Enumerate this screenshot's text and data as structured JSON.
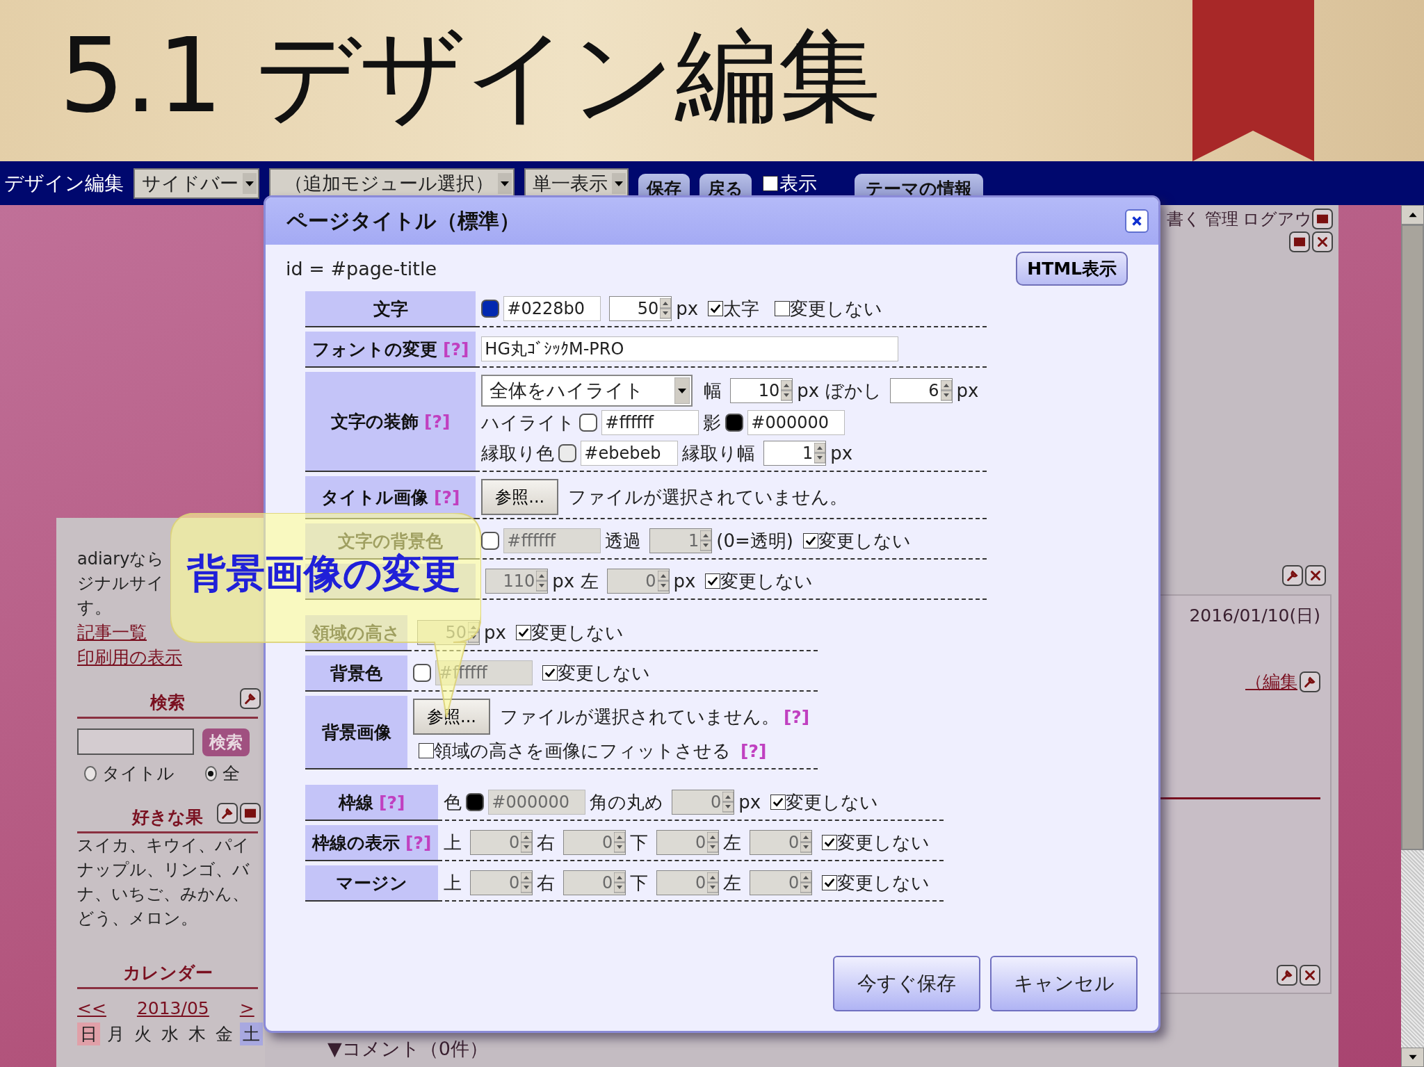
{
  "slide_title": "5.1 デザイン編集",
  "toolbar": {
    "title": "デザイン編集",
    "selects": [
      "サイドバー",
      "（追加モジュール選択）",
      "単一表示"
    ],
    "buttons": [
      "保存",
      "戻る"
    ],
    "show_check": {
      "label": "表示",
      "checked": false
    },
    "info_button": "テーマの情報"
  },
  "sidebar": {
    "intro_lines": [
      "adiaryなら",
      "ジナルサイ",
      "す。"
    ],
    "links": [
      "記事一覧",
      "印刷用の表示"
    ],
    "search": {
      "heading": "検索",
      "button": "検索",
      "radios": [
        {
          "label": "タイトル",
          "selected": false
        },
        {
          "label": "全",
          "selected": true
        }
      ]
    },
    "fruits": {
      "heading": "好きな果",
      "lines": [
        "スイカ、キウイ、パイ",
        "ナップル、リンゴ、バ",
        "ナ、いちご、みかん、",
        "どう、メロン。"
      ]
    },
    "calendar": {
      "heading": "カレンダー",
      "prev": "<<",
      "month": "2013/05",
      "next": ">",
      "weekdays": [
        {
          "text": "日",
          "color": "#e0a0a8"
        },
        {
          "text": "月"
        },
        {
          "text": "火"
        },
        {
          "text": "水"
        },
        {
          "text": "木"
        },
        {
          "text": "金"
        },
        {
          "text": "土",
          "color": "#a8a8e0"
        }
      ]
    }
  },
  "main": {
    "top_links": [
      "書く",
      "管理",
      "ログアウ"
    ],
    "date": "2016/01/10(日)",
    "edit_link": "（編集",
    "comments": "▼コメント（0件）"
  },
  "dialog": {
    "title": "ページタイトル（標準）",
    "id_line": "id = #page-title",
    "html_button": "HTML表示",
    "sections": [
      {
        "rows": [
          {
            "label": "文字",
            "lines": [
              [
                {
                  "kind": "swatch",
                  "color": "#0228b0"
                },
                {
                  "kind": "text",
                  "value": "#0228b0",
                  "disabled": false
                },
                {
                  "kind": "spin",
                  "value": "50",
                  "disabled": false
                },
                {
                  "kind": "word",
                  "text": "px"
                },
                {
                  "kind": "check",
                  "label": "太字",
                  "checked": true
                },
                {
                  "kind": "check",
                  "label": "変更しない",
                  "checked": false
                }
              ]
            ]
          },
          {
            "label": "フォントの変更",
            "help": "[?]",
            "lines": [
              [
                {
                  "kind": "long_text",
                  "value": "HG丸ｺﾞｼｯｸM-PRO"
                }
              ]
            ]
          },
          {
            "label": "文字の装飾",
            "help": "[?]",
            "lines": [
              [
                {
                  "kind": "select",
                  "value": "全体をハイライト"
                },
                {
                  "kind": "word",
                  "text": "幅"
                },
                {
                  "kind": "spin",
                  "value": "10",
                  "disabled": false
                },
                {
                  "kind": "word",
                  "text": "px ぼかし"
                },
                {
                  "kind": "spin",
                  "value": "6",
                  "disabled": false
                },
                {
                  "kind": "word",
                  "text": "px"
                }
              ],
              [
                {
                  "kind": "word",
                  "text": "ハイライト"
                },
                {
                  "kind": "swatch",
                  "color": "#ffffff"
                },
                {
                  "kind": "text",
                  "value": "#ffffff",
                  "disabled": false
                },
                {
                  "kind": "word",
                  "text": "影"
                },
                {
                  "kind": "swatch",
                  "color": "#000000"
                },
                {
                  "kind": "text",
                  "value": "#000000",
                  "disabled": false
                }
              ],
              [
                {
                  "kind": "word",
                  "text": "縁取り色"
                },
                {
                  "kind": "swatch",
                  "color": "#ebebeb"
                },
                {
                  "kind": "text",
                  "value": "#ebebeb",
                  "disabled": false
                },
                {
                  "kind": "word",
                  "text": "縁取り幅"
                },
                {
                  "kind": "spin",
                  "value": "1",
                  "disabled": false
                },
                {
                  "kind": "word",
                  "text": "px"
                }
              ]
            ]
          },
          {
            "label": "タイトル画像",
            "help": "[?]",
            "lines": [
              [
                {
                  "kind": "browse",
                  "label": "参照..."
                },
                {
                  "kind": "word",
                  "text": "ファイルが選択されていません。"
                }
              ]
            ]
          },
          {
            "label": "文字の背景色",
            "lines": [
              [
                {
                  "kind": "swatch",
                  "color": "#ffffff"
                },
                {
                  "kind": "text",
                  "value": "#ffffff",
                  "disabled": true
                },
                {
                  "kind": "word",
                  "text": "透過"
                },
                {
                  "kind": "spin",
                  "value": "1",
                  "disabled": true
                },
                {
                  "kind": "word",
                  "text": "(0=透明)"
                },
                {
                  "kind": "check",
                  "label": "変更しない",
                  "checked": true
                }
              ]
            ]
          },
          {
            "lines": [
              [
                {
                  "kind": "spin",
                  "value": "110",
                  "disabled": true
                },
                {
                  "kind": "word",
                  "text": "px 左"
                },
                {
                  "kind": "spin",
                  "value": "0",
                  "disabled": true
                },
                {
                  "kind": "word",
                  "text": "px"
                },
                {
                  "kind": "check",
                  "label": "変更しない",
                  "checked": true
                }
              ]
            ]
          }
        ]
      },
      {
        "rows": [
          {
            "label": "領域の高さ",
            "lines": [
              [
                {
                  "kind": "spin",
                  "value": "50",
                  "disabled": true
                },
                {
                  "kind": "word",
                  "text": "px"
                },
                {
                  "kind": "check",
                  "label": "変更しない",
                  "checked": true
                }
              ]
            ]
          },
          {
            "label": "背景色",
            "lines": [
              [
                {
                  "kind": "swatch",
                  "color": "#ffffff"
                },
                {
                  "kind": "text",
                  "value": "#ffffff",
                  "disabled": true
                },
                {
                  "kind": "check",
                  "label": "変更しない",
                  "checked": true
                }
              ]
            ]
          },
          {
            "label": "背景画像",
            "lines": [
              [
                {
                  "kind": "browse",
                  "label": "参照..."
                },
                {
                  "kind": "word",
                  "text": "ファイルが選択されていません。"
                },
                {
                  "kind": "help",
                  "text": "[?]"
                }
              ],
              [
                {
                  "kind": "check",
                  "label": "領域の高さを画像にフィットさせる",
                  "checked": false
                },
                {
                  "kind": "help",
                  "text": "[?]"
                }
              ]
            ]
          }
        ]
      },
      {
        "rows": [
          {
            "label": "枠線",
            "help": "[?]",
            "lines": [
              [
                {
                  "kind": "word",
                  "text": "色"
                },
                {
                  "kind": "swatch",
                  "color": "#000000"
                },
                {
                  "kind": "text",
                  "value": "#000000",
                  "disabled": true
                },
                {
                  "kind": "word",
                  "text": "角の丸め"
                },
                {
                  "kind": "spin",
                  "value": "0",
                  "disabled": true
                },
                {
                  "kind": "word",
                  "text": "px"
                },
                {
                  "kind": "check",
                  "label": "変更しない",
                  "checked": true
                }
              ]
            ]
          },
          {
            "label": "枠線の表示",
            "help": "[?]",
            "lines": [
              [
                {
                  "kind": "word",
                  "text": "上"
                },
                {
                  "kind": "spin",
                  "value": "0",
                  "disabled": true
                },
                {
                  "kind": "word",
                  "text": "右"
                },
                {
                  "kind": "spin",
                  "value": "0",
                  "disabled": true
                },
                {
                  "kind": "word",
                  "text": "下"
                },
                {
                  "kind": "spin",
                  "value": "0",
                  "disabled": true
                },
                {
                  "kind": "word",
                  "text": "左"
                },
                {
                  "kind": "spin",
                  "value": "0",
                  "disabled": true
                },
                {
                  "kind": "check",
                  "label": "変更しない",
                  "checked": true
                }
              ]
            ]
          },
          {
            "label": "マージン",
            "lines": [
              [
                {
                  "kind": "word",
                  "text": "上"
                },
                {
                  "kind": "spin",
                  "value": "0",
                  "disabled": true
                },
                {
                  "kind": "word",
                  "text": "右"
                },
                {
                  "kind": "spin",
                  "value": "0",
                  "disabled": true
                },
                {
                  "kind": "word",
                  "text": "下"
                },
                {
                  "kind": "spin",
                  "value": "0",
                  "disabled": true
                },
                {
                  "kind": "word",
                  "text": "左"
                },
                {
                  "kind": "spin",
                  "value": "0",
                  "disabled": true
                },
                {
                  "kind": "check",
                  "label": "変更しない",
                  "checked": true
                }
              ]
            ]
          }
        ]
      }
    ],
    "buttons": [
      "今すぐ保存",
      "キャンセル"
    ]
  },
  "callout": "背景画像の変更"
}
